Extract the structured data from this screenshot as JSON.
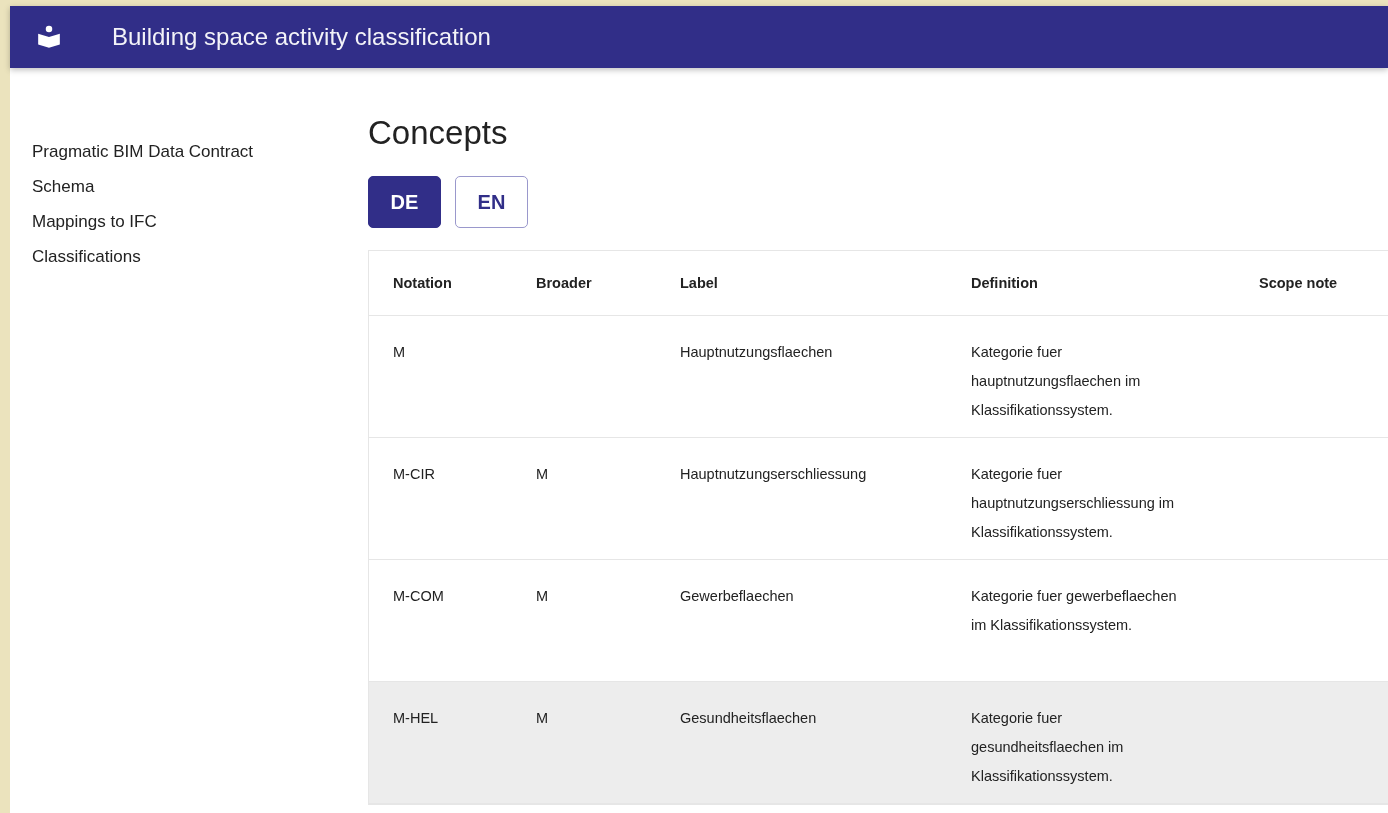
{
  "app_bar": {
    "title": "Building space activity classification"
  },
  "sidebar": {
    "items": [
      "Pragmatic BIM Data Contract",
      "Schema",
      "Mappings to IFC",
      "Classifications"
    ]
  },
  "page": {
    "title": "Concepts"
  },
  "language_buttons": [
    {
      "label": "DE",
      "selected": true
    },
    {
      "label": "EN",
      "selected": false
    }
  ],
  "table": {
    "columns": [
      "Notation",
      "Broader",
      "Label",
      "Definition",
      "Scope note"
    ],
    "rows": [
      {
        "notation": "M",
        "broader": "",
        "label": "Hauptnutzungsflaechen",
        "definition": "Kategorie fuer hauptnutzungsflaechen im Klassifikationssystem.",
        "highlighted": false
      },
      {
        "notation": "M-CIR",
        "broader": "M",
        "label": "Hauptnutzungserschliessung",
        "definition": "Kategorie fuer hauptnutzungserschliessung im Klassifikationssystem.",
        "highlighted": false
      },
      {
        "notation": "M-COM",
        "broader": "M",
        "label": "Gewerbeflaechen",
        "definition": "Kategorie fuer gewerbeflaechen im Klassifikationssystem.",
        "highlighted": false
      },
      {
        "notation": "M-HEL",
        "broader": "M",
        "label": "Gesundheitsflaechen",
        "definition": "Kategorie fuer gesundheitsflaechen im Klassifikationssystem.",
        "highlighted": true
      }
    ]
  }
}
